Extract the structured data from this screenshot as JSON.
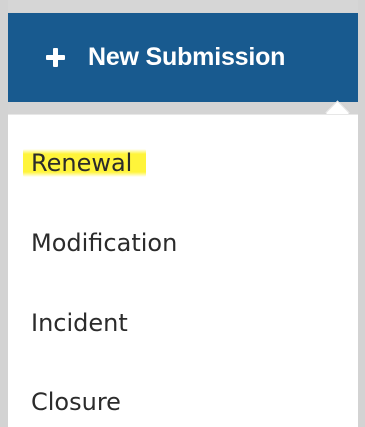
{
  "new_submission": {
    "label": "New Submission",
    "icon": "plus-icon",
    "background_color": "#185a8f",
    "text_color": "#ffffff"
  },
  "menu": {
    "items": [
      {
        "label": "Renewal",
        "highlighted": true
      },
      {
        "label": "Modification",
        "highlighted": false
      },
      {
        "label": "Incident",
        "highlighted": false
      },
      {
        "label": "Closure",
        "highlighted": false
      }
    ]
  },
  "highlight_color": "#fff43a"
}
